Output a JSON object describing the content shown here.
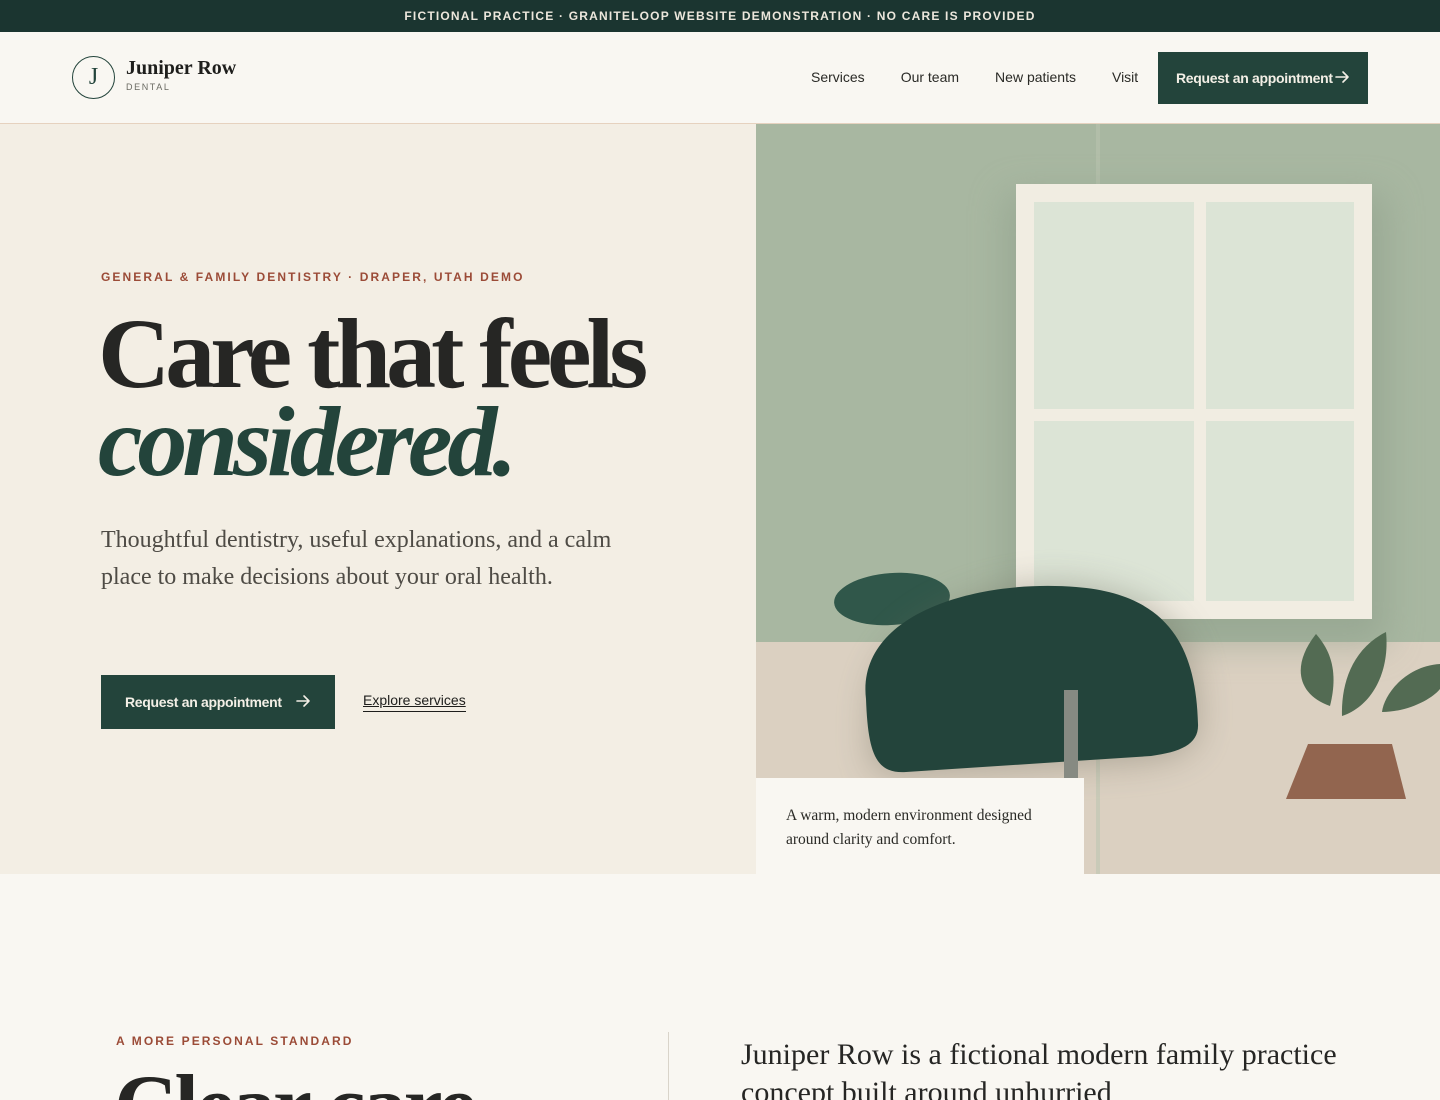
{
  "banner": {
    "text": "FICTIONAL PRACTICE · GRANITELOOP WEBSITE DEMONSTRATION · NO CARE IS PROVIDED"
  },
  "logo": {
    "monogram": "J",
    "name": "Juniper Row",
    "subtitle": "DENTAL"
  },
  "nav": {
    "items": [
      "Services",
      "Our team",
      "New patients",
      "Visit"
    ]
  },
  "header": {
    "cta_label": "Request an appointment"
  },
  "hero": {
    "eyebrow": "GENERAL & FAMILY DENTISTRY · DRAPER, UTAH DEMO",
    "headline_line1": "Care that feels",
    "headline_line2": "considered.",
    "lede": "Thoughtful dentistry, useful explanations, and a calm place to make decisions about your oral health.",
    "primary_cta": "Request an appointment",
    "secondary_cta": "Explore services",
    "caption": "A warm, modern environment designed around clarity and comfort."
  },
  "section2": {
    "eyebrow": "A MORE PERSONAL STANDARD",
    "heading": "Clear care",
    "body": "Juniper Row is a fictional modern family practice concept built around unhurried"
  },
  "colors": {
    "brand_green": "#23443b",
    "banner_bg": "#1b3530",
    "accent_rust": "#9b4b37",
    "hero_bg": "#f3eee4"
  },
  "icons": {
    "arrow": "arrow-right-icon"
  }
}
